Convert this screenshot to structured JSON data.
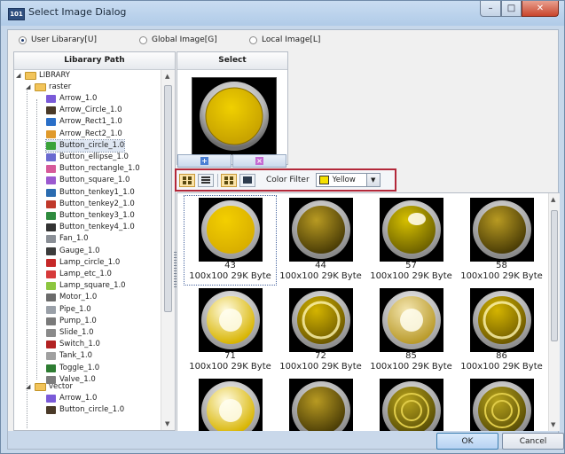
{
  "window": {
    "icon_text": "101",
    "title": "Select Image Dialog"
  },
  "radios": [
    {
      "label": "User Libarary[U]",
      "selected": true
    },
    {
      "label": "Global Image[G]",
      "selected": false
    },
    {
      "label": "Local Image[L]",
      "selected": false
    }
  ],
  "tree_panel": {
    "header": "Libarary Path",
    "root": "LIBRARY",
    "raster_folder": "raster",
    "raster_items": [
      {
        "label": "Arrow_1.0",
        "icon": "arrow-icon",
        "color": "#7a5ad8"
      },
      {
        "label": "Arrow_Circle_1.0",
        "icon": "arrow-circle-icon",
        "color": "#4a3a28"
      },
      {
        "label": "Arrow_Rect1_1.0",
        "icon": "arrow-rect-icon",
        "color": "#2a6fc8"
      },
      {
        "label": "Arrow_Rect2_1.0",
        "icon": "arrow-rect-icon",
        "color": "#e09a2c"
      },
      {
        "label": "Button_circle_1.0",
        "icon": "button-circle-icon",
        "color": "#3aa33a",
        "selected": true
      },
      {
        "label": "Button_ellipse_1.0",
        "icon": "button-ellipse-icon",
        "color": "#6a6ad0"
      },
      {
        "label": "Button_rectangle_1.0",
        "icon": "button-rectangle-icon",
        "color": "#d65a9a"
      },
      {
        "label": "Button_square_1.0",
        "icon": "button-square-icon",
        "color": "#9b59d0"
      },
      {
        "label": "Button_tenkey1_1.0",
        "icon": "tenkey-icon",
        "color": "#2b6cb0"
      },
      {
        "label": "Button_tenkey2_1.0",
        "icon": "tenkey-icon",
        "color": "#c0392b"
      },
      {
        "label": "Button_tenkey3_1.0",
        "icon": "tenkey-icon",
        "color": "#2e8b3e"
      },
      {
        "label": "Button_tenkey4_1.0",
        "icon": "tenkey-icon",
        "color": "#333333"
      },
      {
        "label": "Fan_1.0",
        "icon": "fan-icon",
        "color": "#8a8f96"
      },
      {
        "label": "Gauge_1.0",
        "icon": "gauge-icon",
        "color": "#3c3c3c"
      },
      {
        "label": "Lamp_circle_1.0",
        "icon": "lamp-circle-icon",
        "color": "#c62828"
      },
      {
        "label": "Lamp_etc_1.0",
        "icon": "lamp-etc-icon",
        "color": "#d63a3a"
      },
      {
        "label": "Lamp_square_1.0",
        "icon": "lamp-square-icon",
        "color": "#8cc63f"
      },
      {
        "label": "Motor_1.0",
        "icon": "motor-icon",
        "color": "#6b6b6b"
      },
      {
        "label": "Pipe_1.0",
        "icon": "pipe-icon",
        "color": "#9aa0a8"
      },
      {
        "label": "Pump_1.0",
        "icon": "pump-icon",
        "color": "#7a7a7a"
      },
      {
        "label": "Slide_1.0",
        "icon": "slide-icon",
        "color": "#8a8a8a"
      },
      {
        "label": "Switch_1.0",
        "icon": "switch-icon",
        "color": "#b22222"
      },
      {
        "label": "Tank_1.0",
        "icon": "tank-icon",
        "color": "#a0a0a0"
      },
      {
        "label": "Toggle_1.0",
        "icon": "toggle-icon",
        "color": "#2e7d32"
      },
      {
        "label": "Valve_1.0",
        "icon": "valve-icon",
        "color": "#7d7d7d"
      }
    ],
    "vector_folder": "vector",
    "vector_items": [
      {
        "label": "Arrow_1.0",
        "icon": "arrow-icon",
        "color": "#7a5ad8"
      },
      {
        "label": "Button_circle_1.0",
        "icon": "button-circle-icon",
        "color": "#4a3a28"
      }
    ]
  },
  "select_panel": {
    "header": "Select"
  },
  "toolbar": {
    "color_filter_label": "Color Filter",
    "color_filter_value": "Yellow",
    "color_filter_swatch": "#f5e000"
  },
  "gallery": {
    "items": [
      {
        "id": "43",
        "size": "100x100 29K Byte",
        "selected": true,
        "style": "flat"
      },
      {
        "id": "44",
        "size": "100x100 29K Byte",
        "style": "dark"
      },
      {
        "id": "57",
        "size": "100x100 29K Byte",
        "style": "glossy"
      },
      {
        "id": "58",
        "size": "100x100 29K Byte",
        "style": "dark"
      },
      {
        "id": "71",
        "size": "100x100 29K Byte",
        "style": "bright"
      },
      {
        "id": "72",
        "size": "100x100 29K Byte",
        "style": "ring"
      },
      {
        "id": "85",
        "size": "100x100 29K Byte",
        "style": "pale"
      },
      {
        "id": "86",
        "size": "100x100 29K Byte",
        "style": "ring"
      },
      {
        "style": "bright"
      },
      {
        "style": "dark"
      },
      {
        "style": "concentric"
      },
      {
        "style": "concentric"
      }
    ]
  },
  "buttons": {
    "ok": "OK",
    "cancel": "Cancel"
  },
  "colors": {
    "accent_border": "#b3283a",
    "selection": "#dfe7f3",
    "yellow": "#f5d000"
  }
}
